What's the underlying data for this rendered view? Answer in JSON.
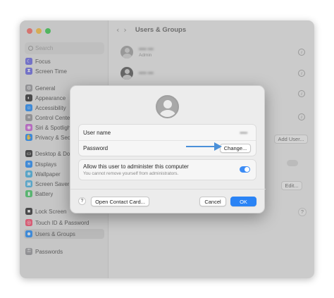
{
  "search": {
    "placeholder": "Search"
  },
  "sidebar": {
    "items": [
      {
        "label": "Focus",
        "icon": "moon-icon",
        "color": "#5e5ce6"
      },
      {
        "label": "Screen Time",
        "icon": "hourglass-icon",
        "color": "#5e5ce6"
      },
      {
        "label": "General",
        "icon": "gear-icon",
        "color": "#8e8e93"
      },
      {
        "label": "Appearance",
        "icon": "appearance-icon",
        "color": "#1c1c1e"
      },
      {
        "label": "Accessibility",
        "icon": "accessibility-icon",
        "color": "#0a84ff"
      },
      {
        "label": "Control Cente",
        "icon": "control-center-icon",
        "color": "#8e8e93"
      },
      {
        "label": "Siri & Spotligh",
        "icon": "siri-icon",
        "color": "#c94fd8"
      },
      {
        "label": "Privacy & Sec",
        "icon": "hand-icon",
        "color": "#0a84ff"
      },
      {
        "label": "Desktop & Do",
        "icon": "desktop-icon",
        "color": "#1c1c1e"
      },
      {
        "label": "Displays",
        "icon": "display-icon",
        "color": "#0a84ff"
      },
      {
        "label": "Wallpaper",
        "icon": "wallpaper-icon",
        "color": "#32ade6"
      },
      {
        "label": "Screen Saver",
        "icon": "screen-saver-icon",
        "color": "#32ade6"
      },
      {
        "label": "Battery",
        "icon": "battery-icon",
        "color": "#34c759"
      },
      {
        "label": "Lock Screen",
        "icon": "lock-icon",
        "color": "#1c1c1e"
      },
      {
        "label": "Touch ID & Password",
        "icon": "fingerprint-icon",
        "color": "#ff375f"
      },
      {
        "label": "Users & Groups",
        "icon": "users-icon",
        "color": "#0a84ff"
      },
      {
        "label": "Passwords",
        "icon": "key-icon",
        "color": "#8e8e93"
      }
    ]
  },
  "header": {
    "title": "Users & Groups"
  },
  "users": [
    {
      "name": "▪▪▪▪ ▪▪▪",
      "role": "Admin"
    },
    {
      "name": "▪▪▪▪ ▪▪▪",
      "role": ""
    }
  ],
  "main_buttons": {
    "add_user": "Add User...",
    "edit": "Edit...",
    "help": "?"
  },
  "dialog": {
    "username_label": "User name",
    "username_value": "▪▪▪▪",
    "password_label": "Password",
    "change_button": "Change...",
    "admin_title": "Allow this user to administer this computer",
    "admin_subtitle": "You cannot remove yourself from administrators.",
    "admin_enabled": true,
    "help_button": "?",
    "contact_button": "Open Contact Card...",
    "cancel_button": "Cancel",
    "ok_button": "OK"
  },
  "colors": {
    "accent": "#2a83f5",
    "arrow": "#4a90d9"
  }
}
